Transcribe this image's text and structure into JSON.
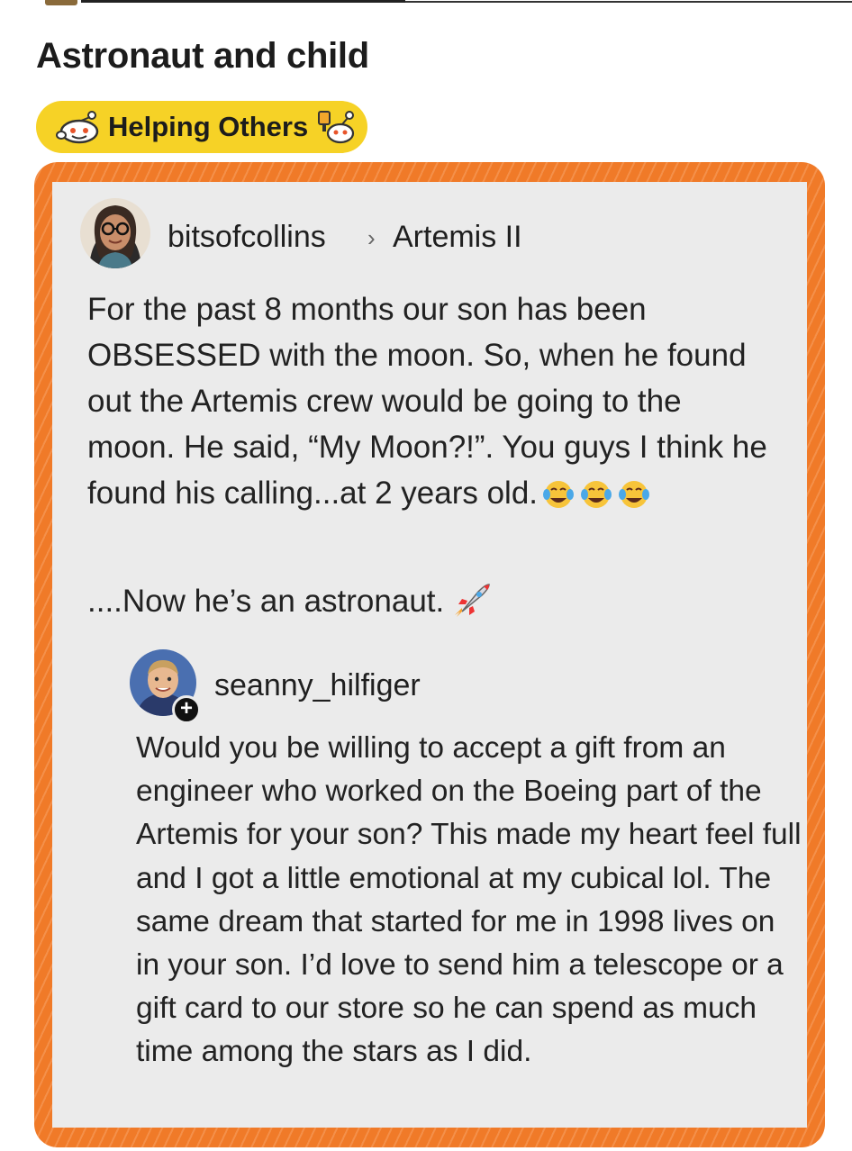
{
  "post": {
    "title": "Astronaut and child",
    "flair": "Helping Others"
  },
  "screenshot": {
    "author": "bitsofcollins",
    "separator": "›",
    "channel": "Artemis II",
    "body": "For the past 8 months our son has been OBSESSED with the moon. So, when he found out the Artemis crew would be going to the moon. He said, “My Moon?!”. You guys I think he found his calling...at 2 years old.",
    "tail": "....Now he’s an astronaut.",
    "reply": {
      "author": "seanny_hilfiger",
      "badge": "+",
      "body": "Would you be willing to accept a gift from an engineer who worked on the Boeing part of the Artemis for your son? This made my heart feel full and I got a little emotional at my cubical lol. The same dream that started for me in 1998 lives on in your son. I’d love to send him a telescope or a gift card to our store so he can spend as much time among the stars as I did."
    }
  },
  "colors": {
    "flair_bg": "#f6d226",
    "frame_orange": "#f07a28",
    "card_bg": "#ebebeb"
  },
  "icons": {
    "flair_left": "reddit-snoo-helping-icon",
    "flair_right": "reddit-snoo-trophy-icon",
    "emoji": "tears-of-joy-emoji",
    "rocket": "rocket-emoji"
  }
}
